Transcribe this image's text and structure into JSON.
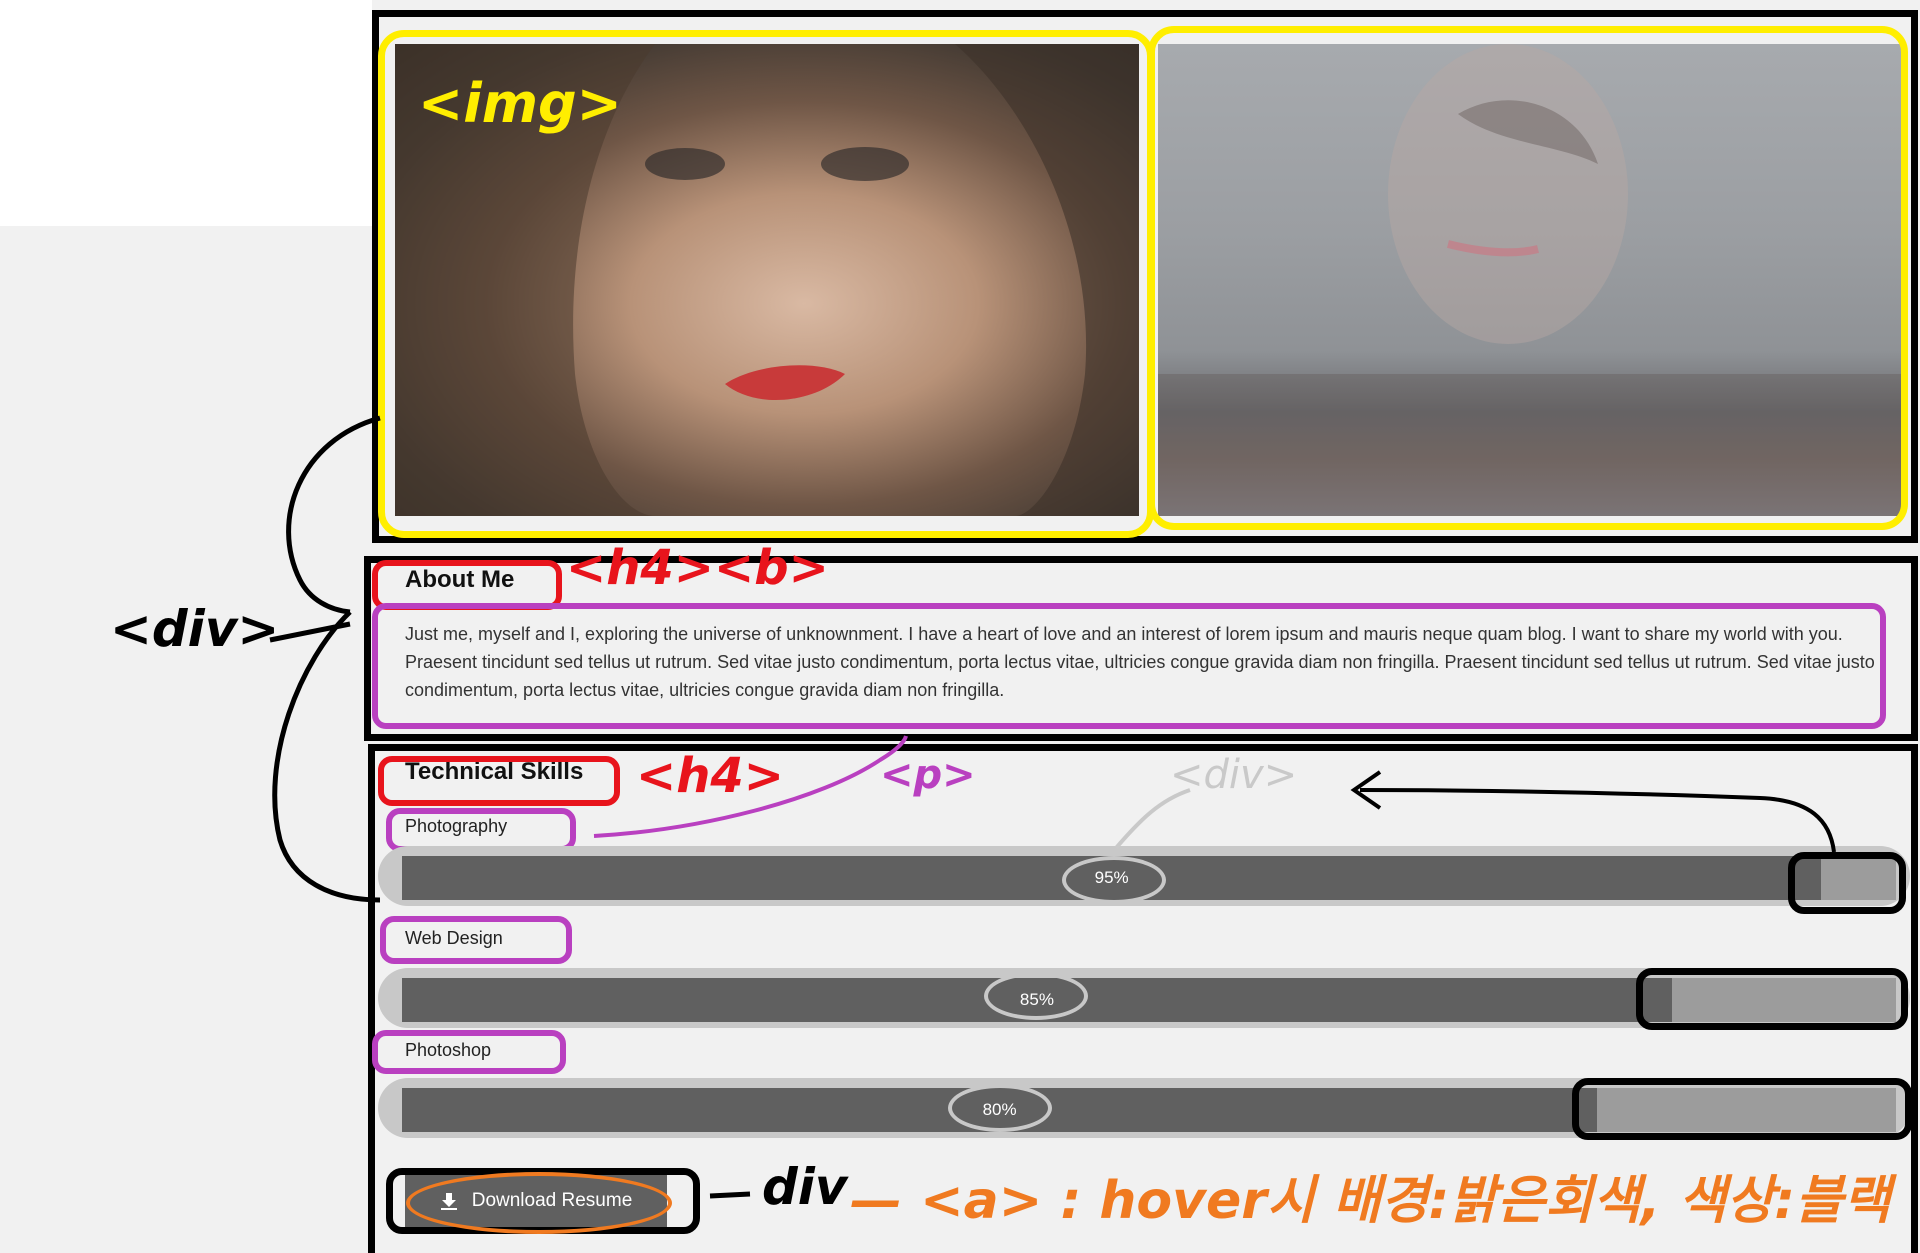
{
  "about": {
    "heading": "About Me",
    "text": "Just me, myself and I, exploring the universe of unknownment. I have a heart of love and an interest of lorem ipsum and mauris neque quam blog. I want to share my world with you. Praesent tincidunt sed tellus ut rutrum. Sed vitae justo condimentum, porta lectus vitae, ultricies congue gravida diam non fringilla. Praesent tincidunt sed tellus ut rutrum. Sed vitae justo condimentum, porta lectus vitae, ultricies congue gravida diam non fringilla."
  },
  "skills": {
    "heading": "Technical Skills",
    "items": [
      {
        "label": "Photography",
        "percent": 95,
        "percent_text": "95%"
      },
      {
        "label": "Web Design",
        "percent": 85,
        "percent_text": "85%"
      },
      {
        "label": "Photoshop",
        "percent": 80,
        "percent_text": "80%"
      }
    ]
  },
  "download": {
    "label": "Download Resume",
    "icon": "download-icon"
  },
  "annotations": {
    "img": "<img>",
    "h4b": "<h4><b>",
    "h4": "<h4>",
    "p": "<p>",
    "div_grey": "<div>",
    "div_left": "<div>",
    "div_button": "div",
    "hover_note": "— <a> : hover시 배경:밝은회색, 색상:블랙"
  },
  "colors": {
    "page_bg": "#f1f1f1",
    "bar_fill": "#606060",
    "bar_remainder": "#9c9c9c",
    "bar_track": "#c8c8c8",
    "annotation_yellow": "#ffee00",
    "annotation_red": "#e8141c",
    "annotation_purple": "#b940c0",
    "annotation_orange": "#f07a20"
  }
}
